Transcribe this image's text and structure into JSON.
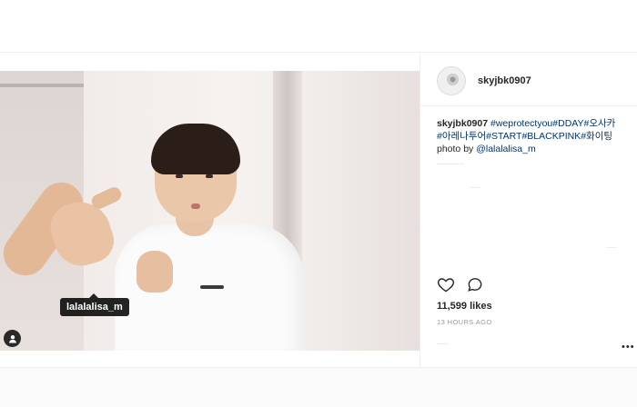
{
  "post": {
    "author": "skyjbk0907",
    "photo_tag": "lalalalisa_m",
    "caption": {
      "username": "skyjbk0907",
      "hashtags": [
        "#weprotectyou",
        "#DDAY",
        "#오사카",
        "#아레나투어",
        "#START",
        "#BLACKPINK",
        "#화이팅"
      ],
      "photo_credit_prefix": "photo by ",
      "photo_credit_user": "@lalalalisa_m"
    },
    "likes": "11,599 likes",
    "time_ago": "13 HOURS AGO",
    "more": "•••"
  },
  "icons": {
    "like": "heart-icon",
    "comment": "comment-icon",
    "tag": "user-tag-icon"
  },
  "colors": {
    "link": "#003569",
    "text": "#262626",
    "muted": "#999999",
    "border": "#efefef"
  }
}
